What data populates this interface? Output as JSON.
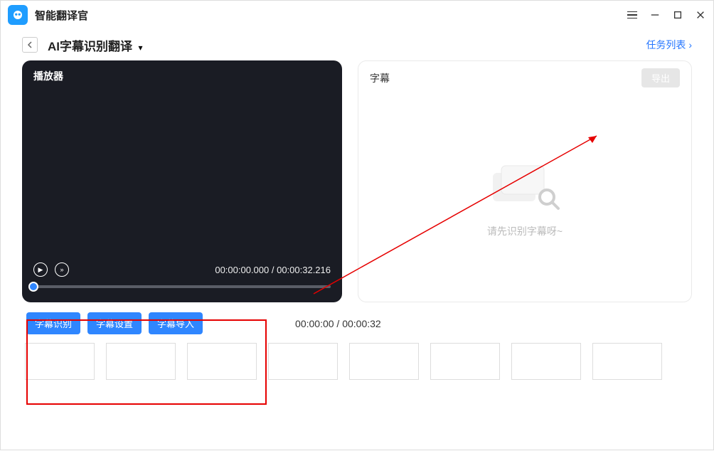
{
  "app": {
    "title": "智能翻译官"
  },
  "nav": {
    "page_title": "AI字幕识别翻译",
    "task_list": "任务列表"
  },
  "player": {
    "title": "播放器",
    "time": "00:00:00.000 / 00:00:32.216"
  },
  "subtitle": {
    "title": "字幕",
    "export": "导出",
    "empty_hint": "请先识别字幕呀~"
  },
  "actions": {
    "recognize": "字幕识别",
    "settings": "字幕设置",
    "import": "字幕导入"
  },
  "timeline": {
    "time": "00:00:00 / 00:00:32"
  }
}
